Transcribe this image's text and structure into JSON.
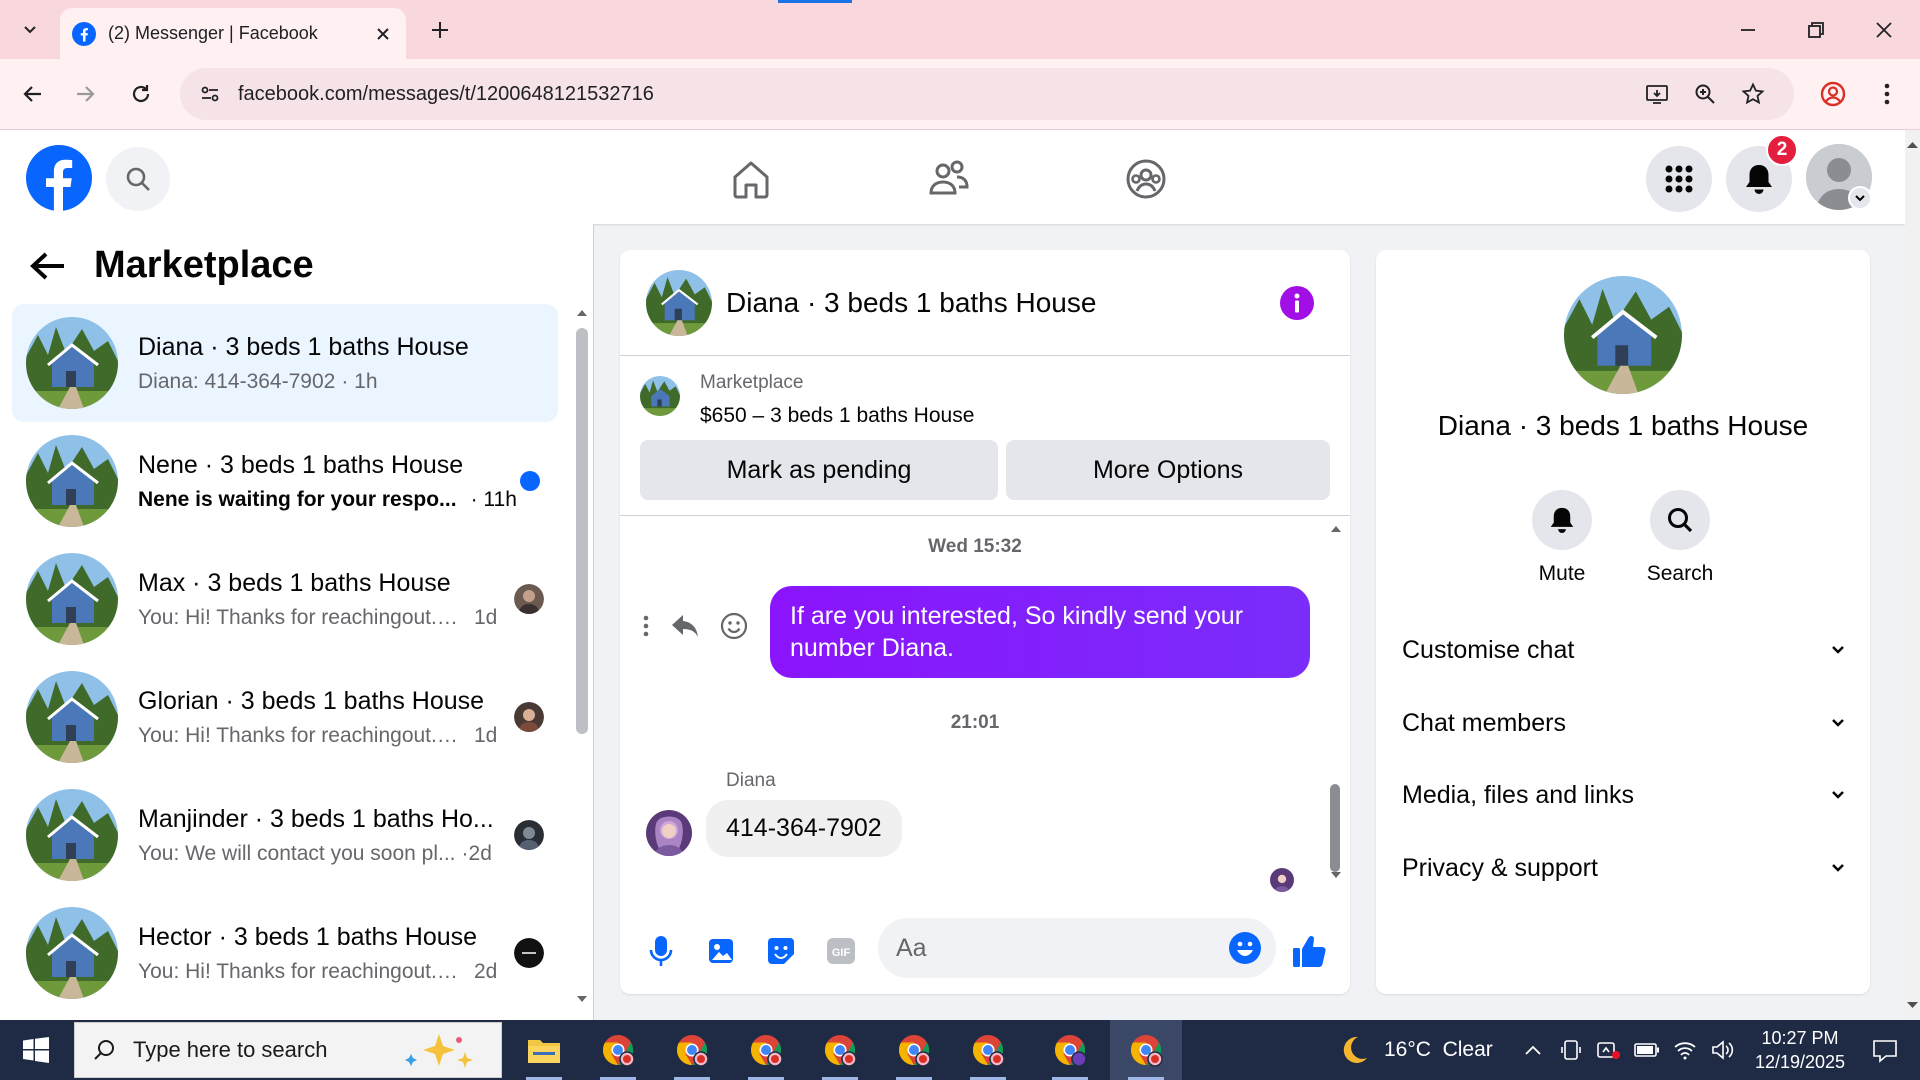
{
  "browser": {
    "tab_title": "(2) Messenger | Facebook",
    "url": "facebook.com/messages/t/1200648121532716"
  },
  "header": {
    "notification_count": "2"
  },
  "sidebar": {
    "title": "Marketplace",
    "conversations": [
      {
        "name": "Diana · 3 beds 1 baths House",
        "preview": "Diana: 414-364-7902",
        "time": "· 1h",
        "state": "active"
      },
      {
        "name": "Nene · 3 beds 1 baths House",
        "preview": "Nene is waiting for your respo...",
        "time": "· 11h",
        "state": "unread"
      },
      {
        "name": "Max · 3 beds 1 baths House",
        "preview": "You: Hi! Thanks for reachingout. ...",
        "time": "1d",
        "state": "read"
      },
      {
        "name": "Glorian · 3 beds 1 baths House",
        "preview": "You: Hi! Thanks for reachingout. ...",
        "time": "1d",
        "state": "read"
      },
      {
        "name": "Manjinder · 3 beds 1 baths Ho...",
        "preview": "You: We will contact you soon pl...",
        "time": "·2d",
        "state": "read"
      },
      {
        "name": "Hector · 3 beds 1 baths House",
        "preview": "You: Hi! Thanks for reachingout. ...",
        "time": "2d",
        "state": "read"
      }
    ]
  },
  "chat": {
    "title": "Diana · 3 beds 1 baths House",
    "listing_category": "Marketplace",
    "listing_title": "$650 – 3 beds 1 baths House",
    "mark_pending_label": "Mark as pending",
    "more_options_label": "More Options",
    "timestamp_1": "Wed 15:32",
    "outgoing_message": "If are you interested, So kindly send your number Diana.",
    "timestamp_2": "21:01",
    "sender_name": "Diana",
    "incoming_message": "414-364-7902",
    "composer_placeholder": "Aa"
  },
  "details": {
    "name": "Diana · 3 beds 1 baths House",
    "mute_label": "Mute",
    "search_label": "Search",
    "sections": [
      "Customise chat",
      "Chat members",
      "Media, files and links",
      "Privacy & support"
    ]
  },
  "taskbar": {
    "search_placeholder": "Type here to search",
    "weather": "16°C  Clear",
    "time": "10:27 PM",
    "date": "12/19/2025"
  },
  "colors": {
    "accent": "#0866ff",
    "messenger_purple": "#8a14fc",
    "unread_blue": "#0866ff",
    "notification_red": "#e41e3f"
  }
}
